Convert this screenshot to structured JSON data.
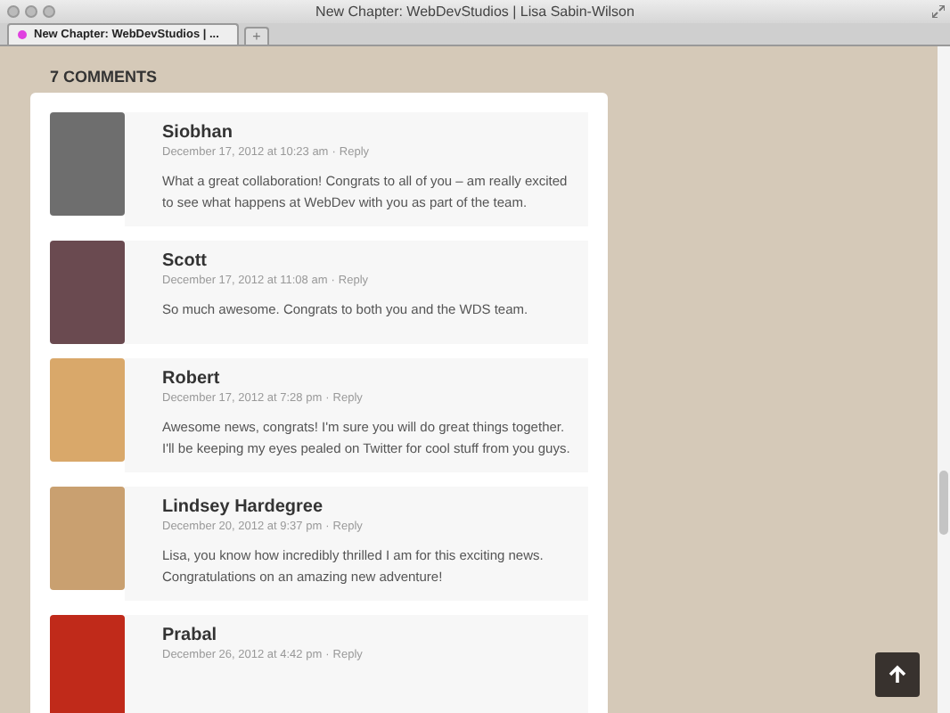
{
  "window": {
    "title": "New Chapter: WebDevStudios | Lisa Sabin-Wilson"
  },
  "tabs": [
    {
      "label": "New Chapter: WebDevStudios | ...",
      "selected": true
    }
  ],
  "new_tab": "+",
  "heading": "7 COMMENTS",
  "comments": [
    {
      "author": "Siobhan",
      "date": "December 17, 2012 at 10:23 am",
      "separator": "·",
      "reply": "Reply",
      "text": "What a great collaboration! Congrats to all of you – am really excited to see what happens at WebDev with you as part of the team."
    },
    {
      "author": "Scott",
      "date": "December 17, 2012 at 11:08 am",
      "separator": "·",
      "reply": "Reply",
      "text": "So much awesome. Congrats to both you and the WDS team."
    },
    {
      "author": "Robert",
      "date": "December 17, 2012 at 7:28 pm",
      "separator": "·",
      "reply": "Reply",
      "text": "Awesome news, congrats! I'm sure you will do great things together. I'll be keeping my eyes pealed on Twitter for cool stuff from you guys."
    },
    {
      "author": "Lindsey Hardegree",
      "date": "December 20, 2012 at 9:37 pm",
      "separator": "·",
      "reply": "Reply",
      "text": "Lisa, you know how incredibly thrilled I am for this exciting news. Congratulations on an amazing new adventure!"
    },
    {
      "author": "Prabal",
      "date": "December 26, 2012 at 4:42 pm",
      "separator": "·",
      "reply": "Reply"
    }
  ]
}
